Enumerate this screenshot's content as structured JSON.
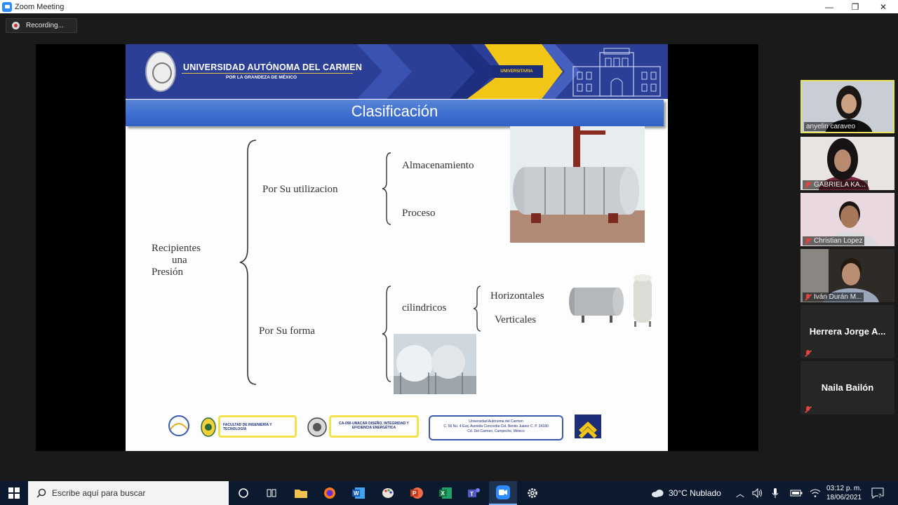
{
  "window": {
    "title": "Zoom Meeting",
    "minimize": "—",
    "restore": "❐",
    "close": "✕"
  },
  "recording": {
    "label": "Recording..."
  },
  "slide": {
    "university_name": "UNIVERSIDAD AUTÓNOMA DEL CARMEN",
    "motto": "POR LA GRANDEZA DE MÉXICO",
    "brand_mark": "UNIVERSITARIA",
    "title": "Clasificación",
    "root": [
      "Recipientes",
      "una",
      "Presión"
    ],
    "branch_use": "Por Su utilizacion",
    "use_items": [
      "Almacenamiento",
      "Proceso"
    ],
    "branch_shape": "Por Su forma",
    "shape_item": "cilindricos",
    "cyl_items": [
      "Horizontales",
      "Verticales"
    ],
    "footer": {
      "faculty": "FACULTAD DE INGENIERÍA Y TECNOLOGÍA",
      "group": "CA-090-UNACAR DISEÑO, INTEGRIDAD Y EFICIENCIA ENERGÉTICA",
      "address": [
        "Universidad Autónoma del Carmen",
        "C. 56 No. 4 Esq. Avenida Concordia Col. Benito Juárez C. P. 24180",
        "Cd. Del Carmen, Campeche, México"
      ]
    }
  },
  "participants": [
    {
      "name": "anyelin caraveo",
      "video": true,
      "muted": false,
      "active": true,
      "bg": "#c9cdd6",
      "skin": "#caa183",
      "hair": "#1d1714",
      "shirt": "#101010"
    },
    {
      "name": "GABRIELA KA...",
      "video": true,
      "muted": true,
      "active": false,
      "bg": "#e7e4e2",
      "skin": "#b88a70",
      "hair": "#181314",
      "shirt": "#7a2a3b"
    },
    {
      "name": "Christian Lopez",
      "video": true,
      "muted": true,
      "active": false,
      "bg": "#e9d9de",
      "skin": "#a7775a",
      "hair": "#1a1512",
      "shirt": "#d9dadd"
    },
    {
      "name": "Iván Durán M...",
      "video": true,
      "muted": true,
      "active": false,
      "bg": "#2e2a28",
      "skin": "#b98e73",
      "hair": "#22190f",
      "shirt": "#9aa6ba"
    },
    {
      "name": "Herrera Jorge A...",
      "video": false,
      "muted": true
    },
    {
      "name": "Naila Bailón",
      "video": false,
      "muted": true
    }
  ],
  "taskbar": {
    "search_placeholder": "Escribe aquí para buscar",
    "weather": "30°C  Nublado",
    "time": "03:12 p. m.",
    "date": "18/06/2021",
    "notifications": "7"
  },
  "colors": {
    "zoom_blue": "#2d8cff",
    "active_border": "#e8e35a",
    "slide_blue": "#2b3f96",
    "slide_yellow": "#f2c617"
  }
}
